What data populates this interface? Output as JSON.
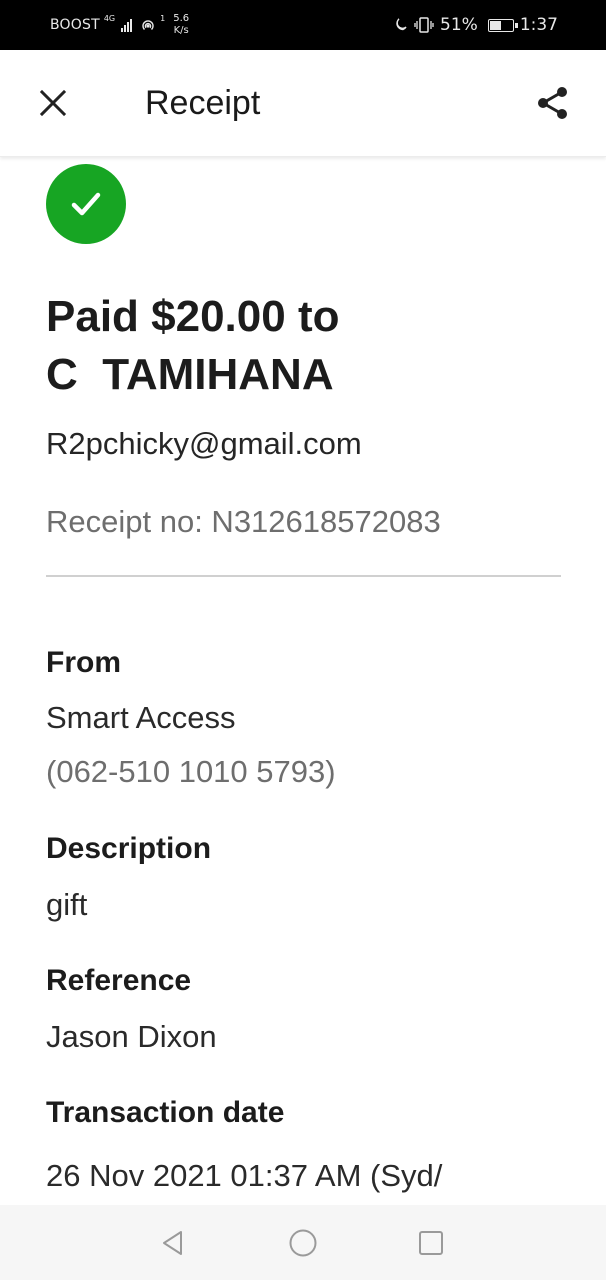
{
  "status_bar": {
    "carrier": "BOOST",
    "network": "4G",
    "speed_value": "5.6",
    "speed_unit": "K/s",
    "data_indicator": "1",
    "battery": "51%",
    "battery_level": 0.51,
    "time": "1:37"
  },
  "app_bar": {
    "title": "Receipt",
    "close_icon": "close-icon",
    "share_icon": "share-icon"
  },
  "receipt": {
    "status_icon": "check-icon",
    "status_color": "#17a523",
    "headline_line1": "Paid $20.00 to",
    "headline_line2": "C  TAMIHANA",
    "payee_email": "R2pchicky@gmail.com",
    "receipt_no": "Receipt no: N312618572083"
  },
  "details": {
    "from_label": "From",
    "from_name": "Smart Access",
    "from_account": "(062-510 1010 5793)",
    "description_label": "Description",
    "description_value": "gift",
    "reference_label": "Reference",
    "reference_value": "Jason Dixon",
    "date_label": "Transaction date",
    "date_value": "26 Nov 2021 01:37 AM (Syd/"
  },
  "nav_bar": {
    "back_icon": "back-triangle-icon",
    "home_icon": "home-circle-icon",
    "recents_icon": "recents-square-icon"
  }
}
